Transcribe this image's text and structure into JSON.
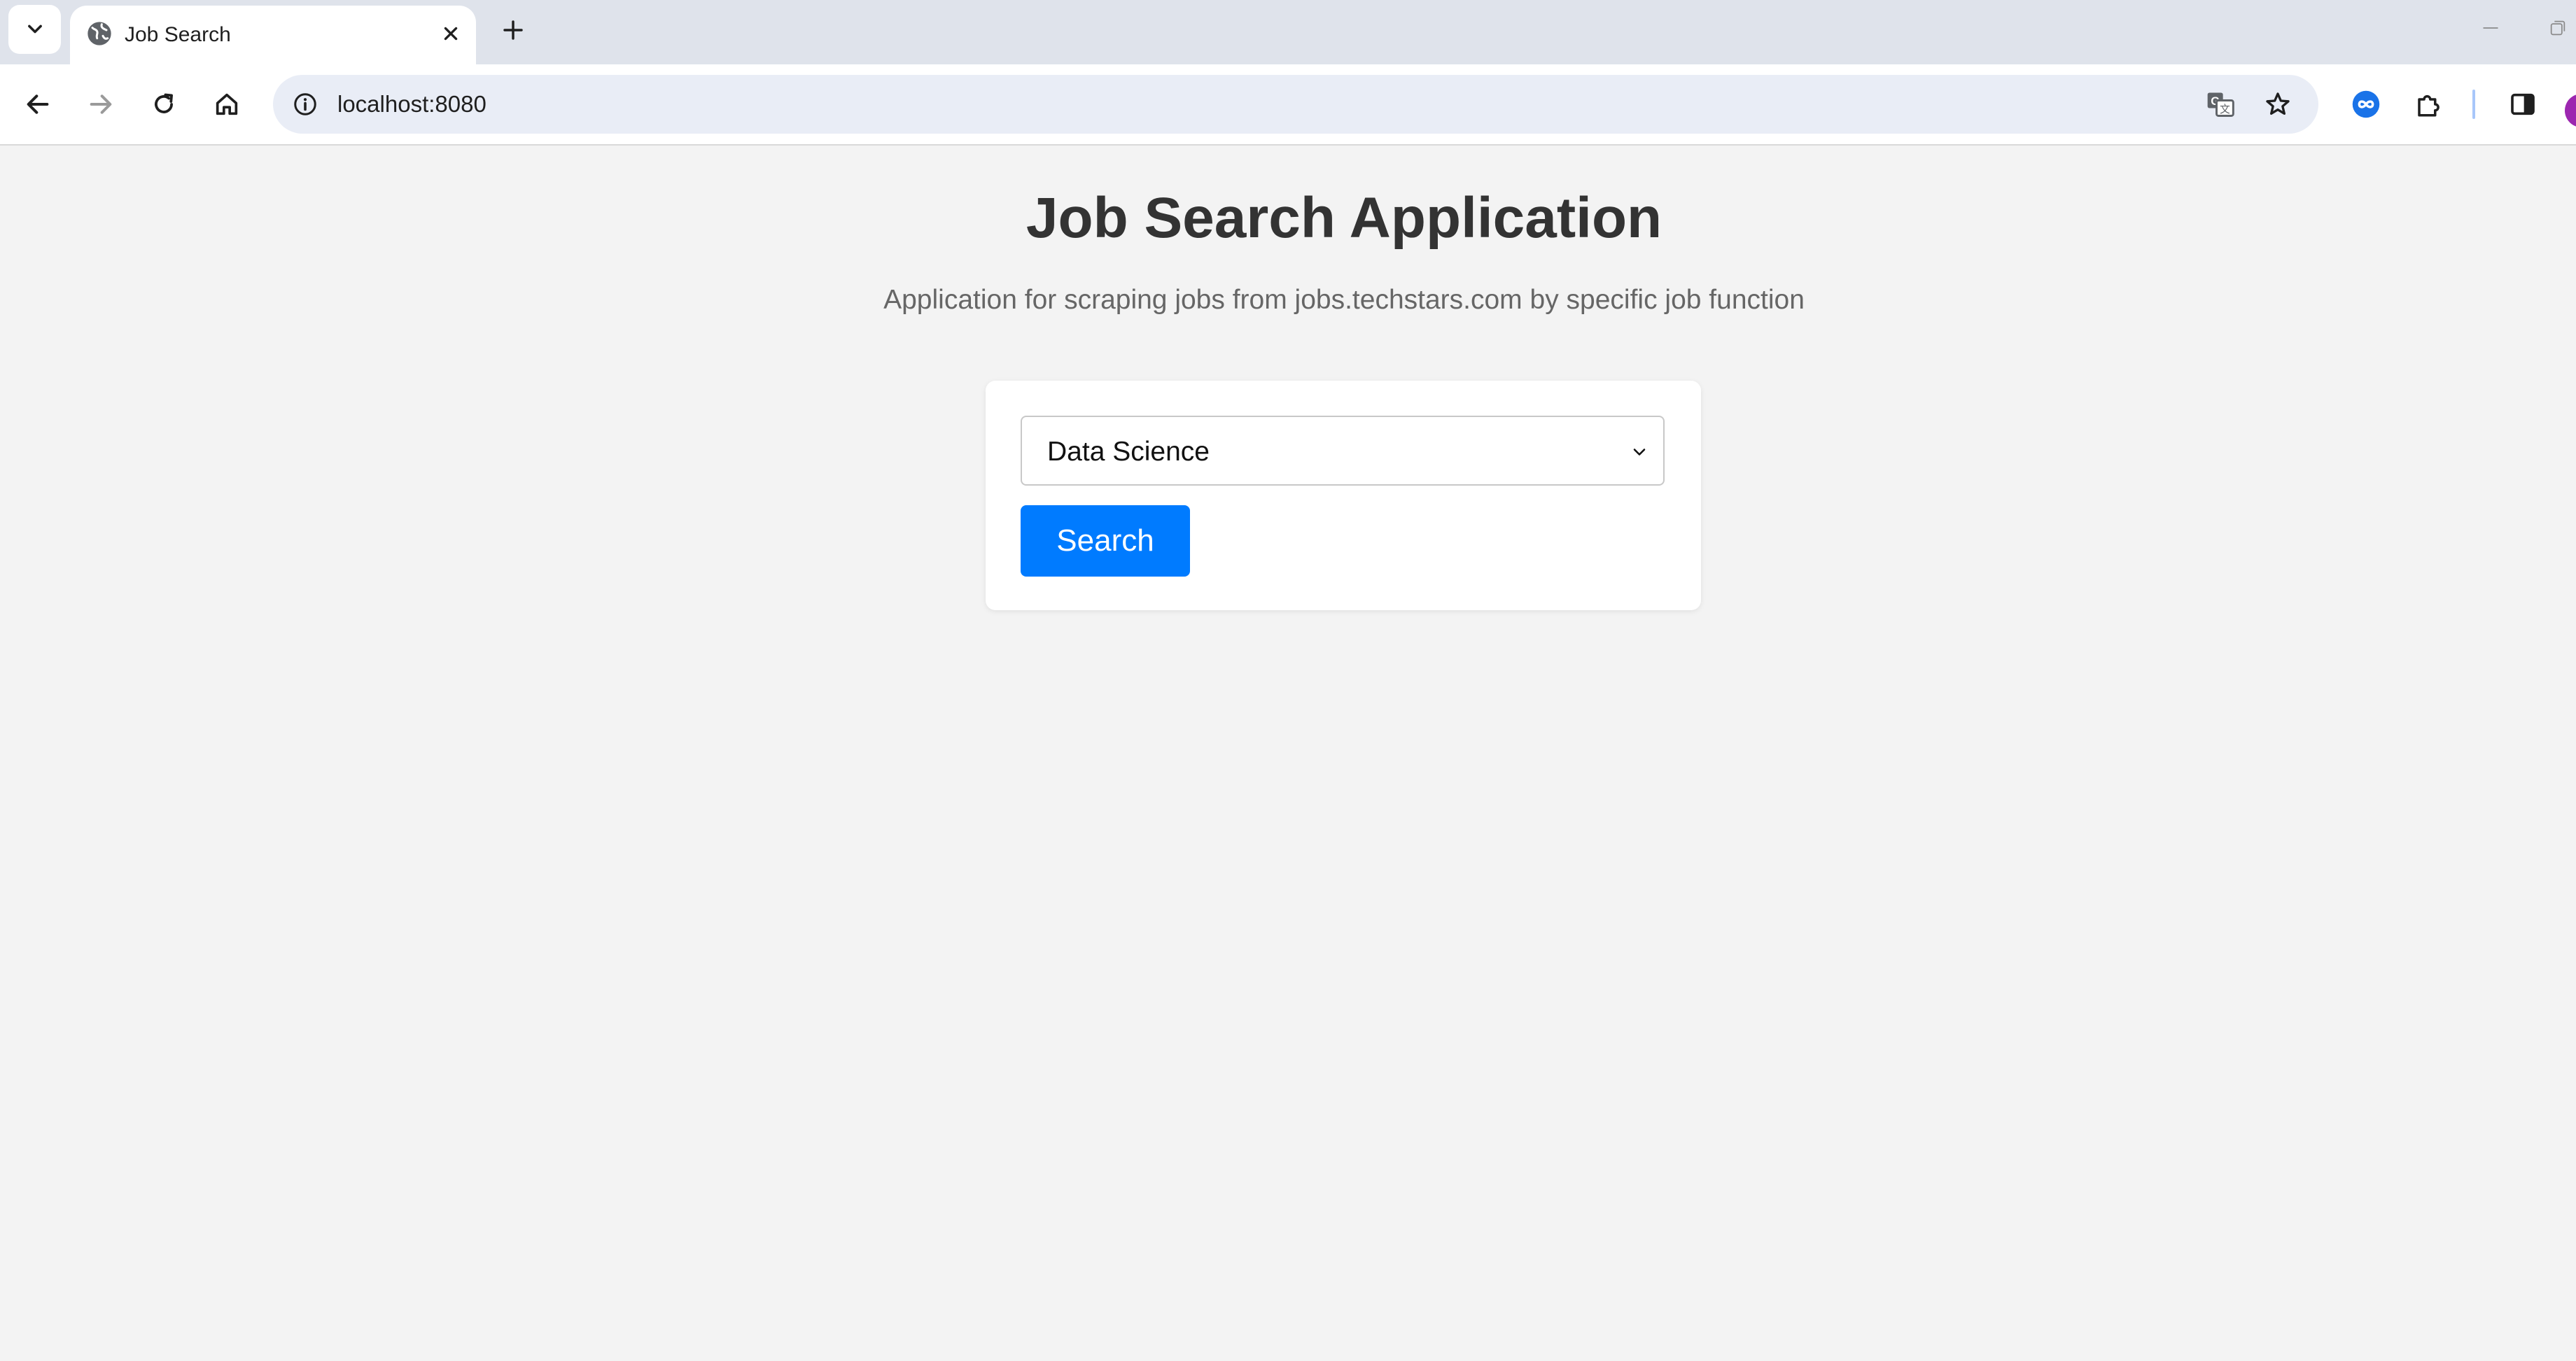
{
  "browser": {
    "tab": {
      "title": "Job Search",
      "favicon": "globe-icon"
    },
    "address_bar": {
      "url": "localhost:8080"
    },
    "icons": {
      "tab_search": "chevron-down-icon",
      "close_tab": "close-icon",
      "new_tab": "plus-icon",
      "back": "arrow-left-icon",
      "forward": "arrow-right-icon",
      "reload": "reload-icon",
      "home": "home-icon",
      "site_info": "info-icon",
      "translate": "translate-icon",
      "bookmark": "star-icon",
      "extension_infinity": "infinity-icon",
      "extensions": "puzzle-icon",
      "side_panel": "side-panel-icon"
    },
    "accent_color": "#007bff"
  },
  "page": {
    "title": "Job Search Application",
    "subtitle": "Application for scraping jobs from jobs.techstars.com by specific job function",
    "form": {
      "job_function_select": {
        "selected": "Data Science"
      },
      "search_button_label": "Search"
    }
  }
}
